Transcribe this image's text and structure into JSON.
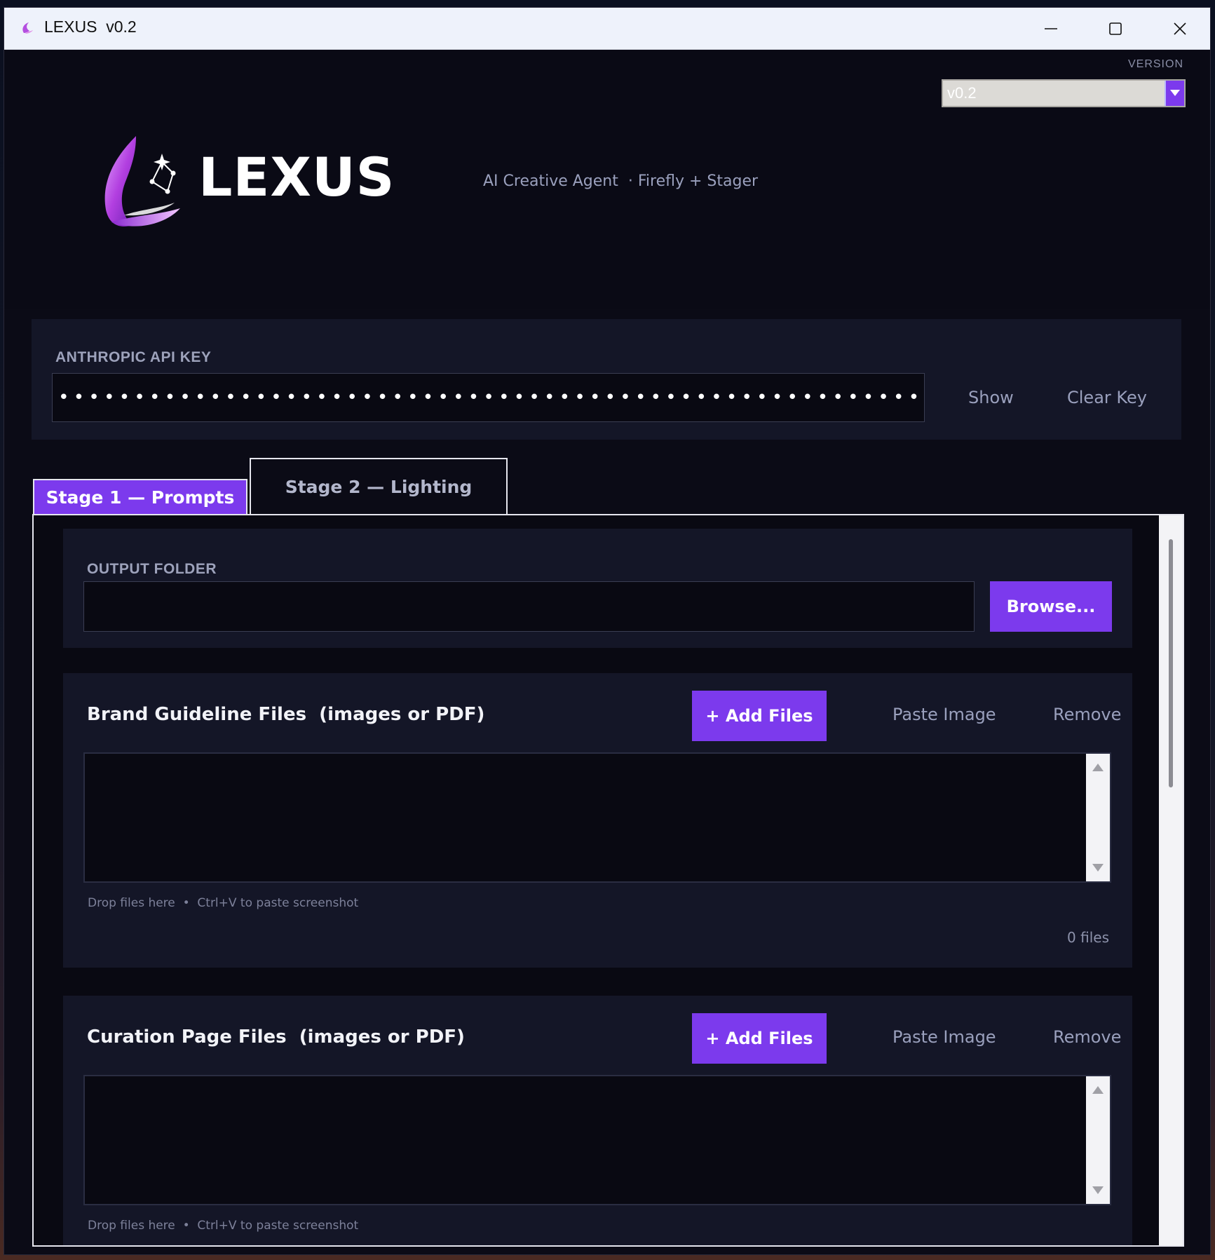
{
  "window": {
    "title": "LEXUS  v0.2"
  },
  "header": {
    "version_label": "VERSION",
    "version_selected": "v0.2",
    "brand_name": "LEXUS",
    "tagline": "AI Creative Agent  · Firefly + Stager"
  },
  "api_key": {
    "label": "ANTHROPIC API KEY",
    "masked_value": "••••••••••••••••••••••••••••••••••••••••••••••••••••••••••••••••••••••••••••••••••••••",
    "show_label": "Show",
    "clear_label": "Clear Key"
  },
  "tabs": [
    {
      "label": "Stage 1 — Prompts",
      "active": true
    },
    {
      "label": "Stage 2 — Lighting",
      "active": false
    }
  ],
  "output_folder": {
    "label": "OUTPUT FOLDER",
    "value": "",
    "browse_label": "Browse..."
  },
  "brand_files": {
    "title": "Brand Guideline Files  (images or PDF)",
    "add_label": "+ Add Files",
    "paste_label": "Paste Image",
    "remove_label": "Remove",
    "hint": "Drop files here  •  Ctrl+V to paste screenshot",
    "count": "0 files"
  },
  "curation_files": {
    "title": "Curation Page Files  (images or PDF)",
    "add_label": "+ Add Files",
    "paste_label": "Paste Image",
    "remove_label": "Remove",
    "hint": "Drop files here  •  Ctrl+V to paste screenshot"
  },
  "colors": {
    "accent": "#7c3aed",
    "background": "#0b0b16",
    "panel": "#141627"
  }
}
